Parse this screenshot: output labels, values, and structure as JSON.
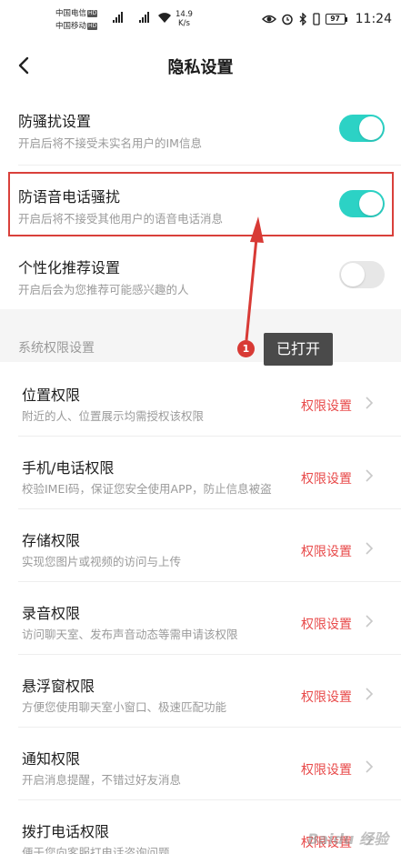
{
  "status_bar": {
    "carrier1": "中国电信",
    "carrier2": "中国移动",
    "hd_label": "HD",
    "net_type": "4G",
    "net_speed_value": "14.9",
    "net_speed_unit": "K/s",
    "battery": "97",
    "time": "11:24"
  },
  "header": {
    "title": "隐私设置",
    "back_icon": "chevron-left-icon"
  },
  "toggles": [
    {
      "title": "防骚扰设置",
      "desc": "开启后将不接受未实名用户的IM信息",
      "on": true
    },
    {
      "title": "防语音电话骚扰",
      "desc": "开启后将不接受其他用户的语音电话消息",
      "on": true
    },
    {
      "title": "个性化推荐设置",
      "desc": "开启后会为您推荐可能感兴趣的人",
      "on": false
    }
  ],
  "section": {
    "label": "系统权限设置"
  },
  "permissions": [
    {
      "title": "位置权限",
      "desc": "附近的人、位置展示均需授权该权限",
      "action": "权限设置"
    },
    {
      "title": "手机/电话权限",
      "desc": "校验IMEI码，保证您安全使用APP，防止信息被盗",
      "action": "权限设置"
    },
    {
      "title": "存储权限",
      "desc": "实现您图片或视频的访问与上传",
      "action": "权限设置"
    },
    {
      "title": "录音权限",
      "desc": "访问聊天室、发布声音动态等需申请该权限",
      "action": "权限设置"
    },
    {
      "title": "悬浮窗权限",
      "desc": "方便您使用聊天室小窗口、极速匹配功能",
      "action": "权限设置"
    },
    {
      "title": "通知权限",
      "desc": "开启消息提醒，不错过好友消息",
      "action": "权限设置"
    },
    {
      "title": "拨打电话权限",
      "desc": "便于您向客服打电话咨询问题",
      "action": "权限设置"
    }
  ],
  "annotation": {
    "badge": "1",
    "tooltip": "已打开"
  },
  "watermark": "Baidu 经验",
  "colors": {
    "toggle_on": "#2cd2c5",
    "action": "#e84a4a",
    "highlight": "#d9403b"
  }
}
